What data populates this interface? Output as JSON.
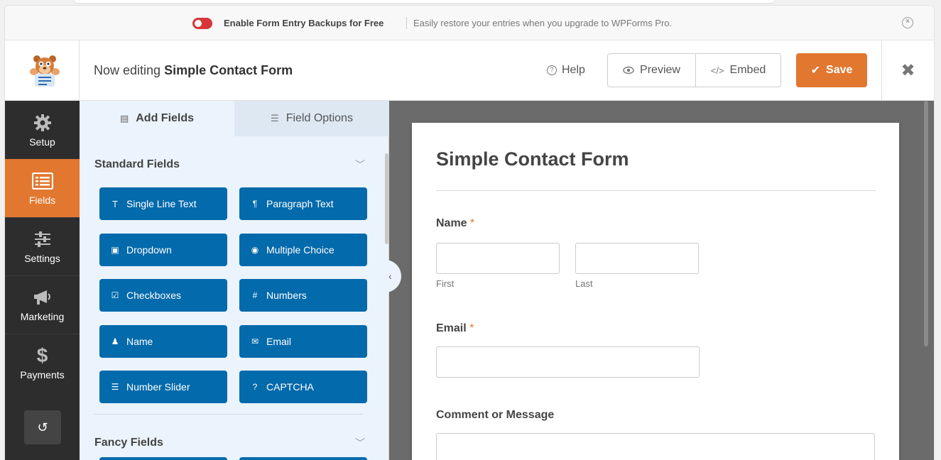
{
  "notice": {
    "title": "Enable Form Entry Backups for Free",
    "description": "Easily restore your entries when you upgrade to WPForms Pro.",
    "toggle_color": "#d63638"
  },
  "header": {
    "editing_prefix": "Now editing",
    "form_name": "Simple Contact Form",
    "help_label": "Help",
    "preview_label": "Preview",
    "embed_label": "Embed",
    "save_label": "Save",
    "accent_color": "#e27730"
  },
  "nav": {
    "items": [
      {
        "label": "Setup",
        "icon": "gear-icon"
      },
      {
        "label": "Fields",
        "icon": "fields-icon",
        "active": true
      },
      {
        "label": "Settings",
        "icon": "sliders-icon"
      },
      {
        "label": "Marketing",
        "icon": "megaphone-icon"
      },
      {
        "label": "Payments",
        "icon": "dollar-icon"
      }
    ],
    "revisions_icon": "revisions-icon"
  },
  "panel": {
    "tabs": [
      {
        "label": "Add Fields",
        "icon": "list-icon"
      },
      {
        "label": "Field Options",
        "icon": "sliders-icon"
      }
    ],
    "sections": [
      {
        "title": "Standard Fields"
      },
      {
        "title": "Fancy Fields"
      }
    ],
    "standard_fields": [
      {
        "label": "Single Line Text",
        "icon": "text-icon"
      },
      {
        "label": "Paragraph Text",
        "icon": "paragraph-icon"
      },
      {
        "label": "Dropdown",
        "icon": "dropdown-icon"
      },
      {
        "label": "Multiple Choice",
        "icon": "radio-icon"
      },
      {
        "label": "Checkboxes",
        "icon": "checkbox-icon"
      },
      {
        "label": "Numbers",
        "icon": "hash-icon"
      },
      {
        "label": "Name",
        "icon": "user-icon"
      },
      {
        "label": "Email",
        "icon": "envelope-icon"
      },
      {
        "label": "Number Slider",
        "icon": "slider-icon"
      },
      {
        "label": "CAPTCHA",
        "icon": "question-icon"
      }
    ],
    "button_color": "#036aab"
  },
  "form": {
    "title": "Simple Contact Form",
    "fields": [
      {
        "label": "Name",
        "required": "*",
        "sub_first": "First",
        "sub_last": "Last"
      },
      {
        "label": "Email",
        "required": "*"
      },
      {
        "label": "Comment or Message"
      }
    ]
  }
}
